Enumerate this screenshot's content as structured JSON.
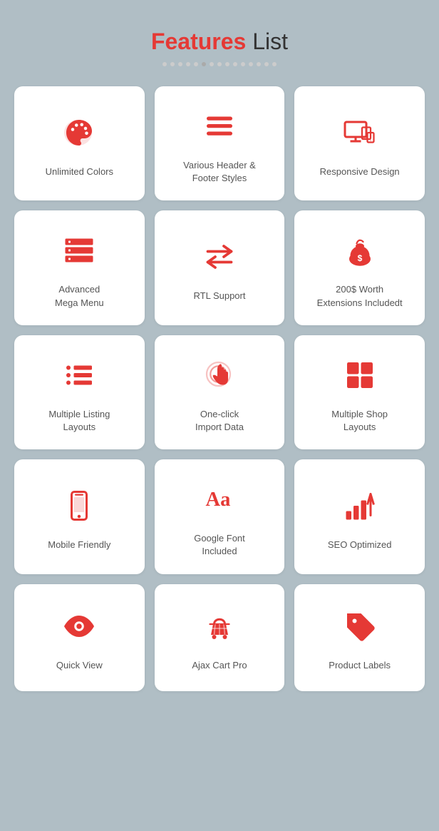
{
  "header": {
    "title_highlight": "Features",
    "title_rest": " List"
  },
  "dots": [
    1,
    2,
    3,
    4,
    5,
    6,
    7,
    8,
    9,
    10,
    11,
    12,
    13,
    14,
    15
  ],
  "cards": [
    {
      "id": "unlimited-colors",
      "label": "Unlimited Colors",
      "icon": "palette"
    },
    {
      "id": "header-footer-styles",
      "label": "Various Header &\nFooter Styles",
      "icon": "hamburger"
    },
    {
      "id": "responsive-design",
      "label": "Responsive Design",
      "icon": "responsive"
    },
    {
      "id": "advanced-mega-menu",
      "label": "Advanced\nMega Menu",
      "icon": "menu-lines"
    },
    {
      "id": "rtl-support",
      "label": "RTL Support",
      "icon": "rtl"
    },
    {
      "id": "extensions",
      "label": "200$ Worth\nExtensions Includedt",
      "icon": "moneybag"
    },
    {
      "id": "multiple-listing",
      "label": "Multiple Listing\nLayouts",
      "icon": "list-layout"
    },
    {
      "id": "one-click-import",
      "label": "One-click\nImport Data",
      "icon": "click"
    },
    {
      "id": "multiple-shop",
      "label": "Multiple Shop\nLayouts",
      "icon": "grid-layout"
    },
    {
      "id": "mobile-friendly",
      "label": "Mobile Friendly",
      "icon": "mobile"
    },
    {
      "id": "google-font",
      "label": "Google Font\nIncluded",
      "icon": "font"
    },
    {
      "id": "seo-optimized",
      "label": "SEO Optimized",
      "icon": "seo"
    },
    {
      "id": "quick-view",
      "label": "Quick View",
      "icon": "eye"
    },
    {
      "id": "ajax-cart",
      "label": "Ajax Cart Pro",
      "icon": "cart"
    },
    {
      "id": "product-labels",
      "label": "Product Labels",
      "icon": "tag"
    }
  ]
}
